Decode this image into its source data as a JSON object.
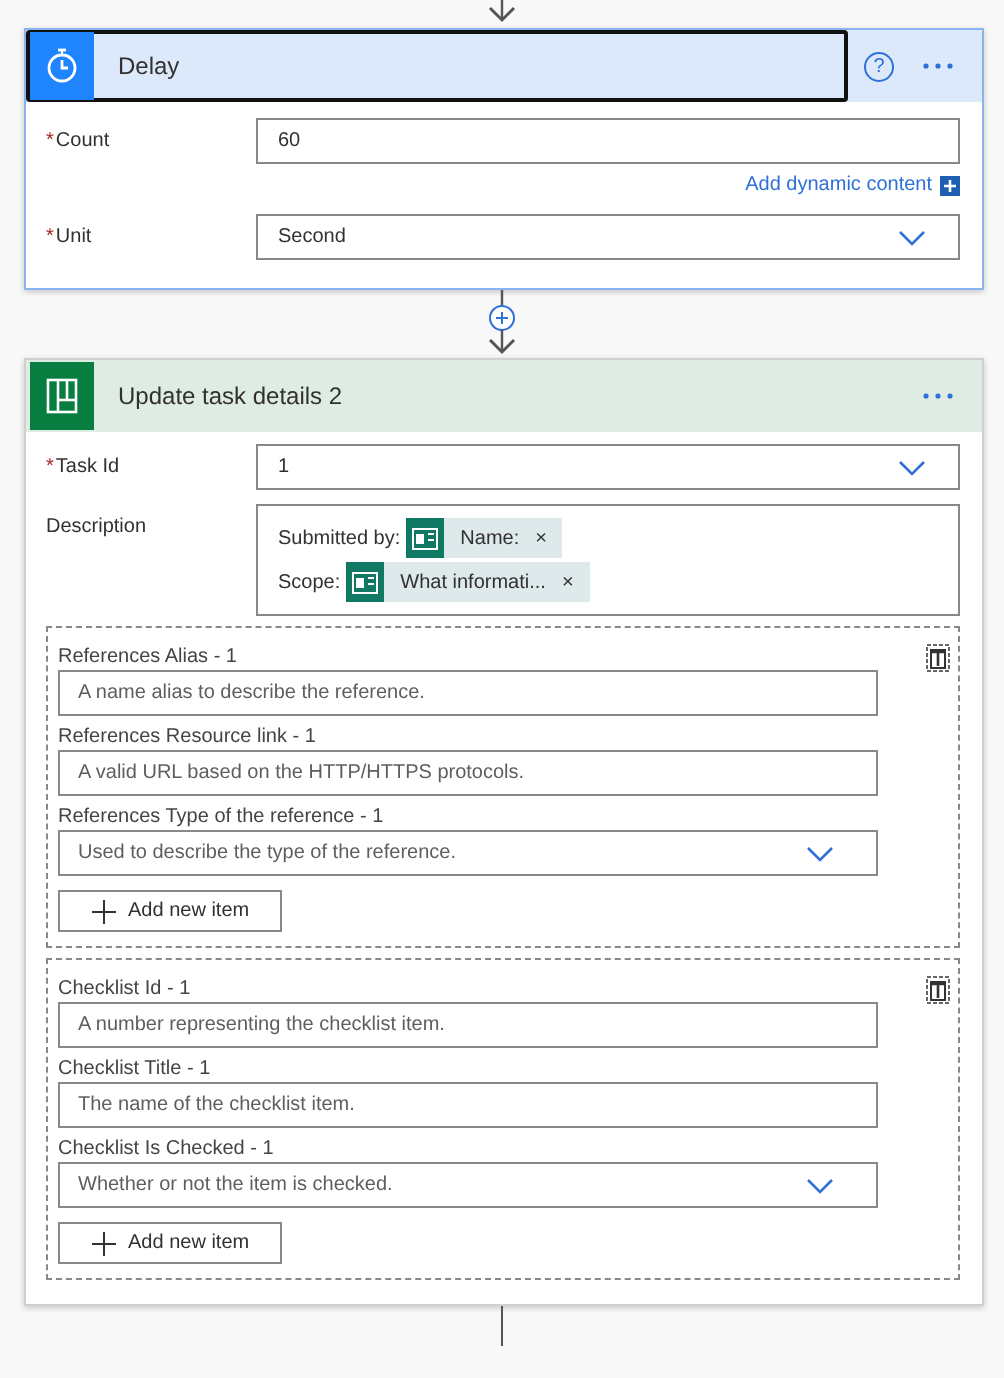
{
  "delay": {
    "title": "Delay",
    "selected": true,
    "help": "?",
    "fields": [
      {
        "kind": "text",
        "required_mark": "*",
        "label": "Count",
        "value": "60",
        "link": "Add dynamic content"
      },
      {
        "kind": "dropdown",
        "required_mark": "*",
        "label": "Unit",
        "value": "Second"
      }
    ]
  },
  "update": {
    "title": "Update task details 2",
    "selected": false,
    "fields": [
      {
        "kind": "dropdown",
        "required_mark": "*",
        "label": "Task Id",
        "value": "1"
      },
      {
        "kind": "tokens",
        "label": "Description",
        "lines": [
          {
            "text": "Submitted by:",
            "token": "Name:",
            "remove": "×"
          },
          {
            "text": "Scope:",
            "token": "What informati...",
            "remove": "×"
          }
        ]
      }
    ],
    "arrays": [
      {
        "fields": [
          {
            "kind": "text",
            "label": "References Alias - 1",
            "placeholder": "A name alias to describe the reference."
          },
          {
            "kind": "text",
            "label": "References Resource link - 1",
            "placeholder": "A valid URL based on the HTTP/HTTPS protocols."
          },
          {
            "kind": "dropdown",
            "label": "References Type of the reference - 1",
            "placeholder": "Used to describe the type of the reference."
          }
        ],
        "add_button": "Add new item"
      },
      {
        "fields": [
          {
            "kind": "text",
            "label": "Checklist Id - 1",
            "placeholder": "A number representing the checklist item."
          },
          {
            "kind": "text",
            "label": "Checklist Title - 1",
            "placeholder": "The name of the checklist item."
          },
          {
            "kind": "dropdown",
            "label": "Checklist Is Checked - 1",
            "placeholder": "Whether or not the item is checked."
          }
        ],
        "add_button": "Add new item"
      }
    ]
  }
}
